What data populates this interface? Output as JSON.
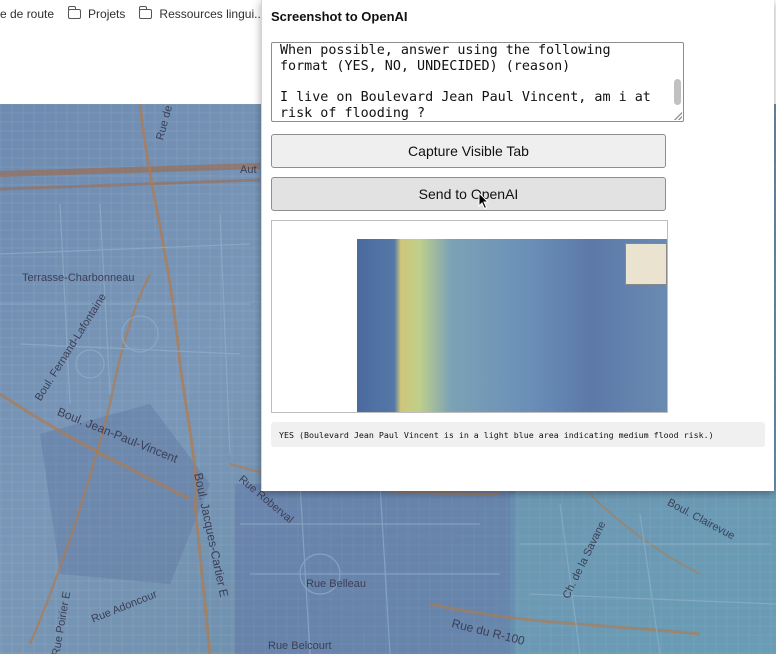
{
  "bookmarks": [
    {
      "label": "e de route",
      "icon": "none"
    },
    {
      "label": "Projets",
      "icon": "folder-icon"
    },
    {
      "label": "Ressources lingui...",
      "icon": "folder-icon"
    },
    {
      "label": "",
      "icon": "sheets-icon"
    }
  ],
  "popup": {
    "title": "Screenshot to OpenAI",
    "prompt_text": "When possible, answer using the following format (YES, NO, UNDECIDED) (reason)\n\nI live on Boulevard Jean Paul Vincent, am i at risk of flooding ?",
    "capture_button": "Capture Visible Tab",
    "send_button": "Send to OpenAI",
    "response": "YES (Boulevard Jean Paul Vincent is in a light blue area indicating medium flood risk.)"
  },
  "map_labels": {
    "terrasse": "Terrasse-Charbonneau",
    "fernand": "Boul. Fernand-Lafontaine",
    "jean_paul": "Boul. Jean-Paul-Vincent",
    "jacques": "Boul. Jacques-Cartier E",
    "roberval": "Rue Roberval",
    "adoncour": "Rue Adoncour",
    "belleau": "Rue Belleau",
    "belcourt": "Rue Belcourt",
    "r100": "Rue du R-100",
    "savane": "Ch. de la Savane",
    "clairevue": "Boul. Clairevue",
    "aut": "Aut",
    "rue_de": "Rue de",
    "poirier": "Rue Poirier E"
  },
  "colors": {
    "flood_blue": "#6f8fb4",
    "button_bg": "#efefef",
    "response_bg": "#f0f0f0"
  }
}
